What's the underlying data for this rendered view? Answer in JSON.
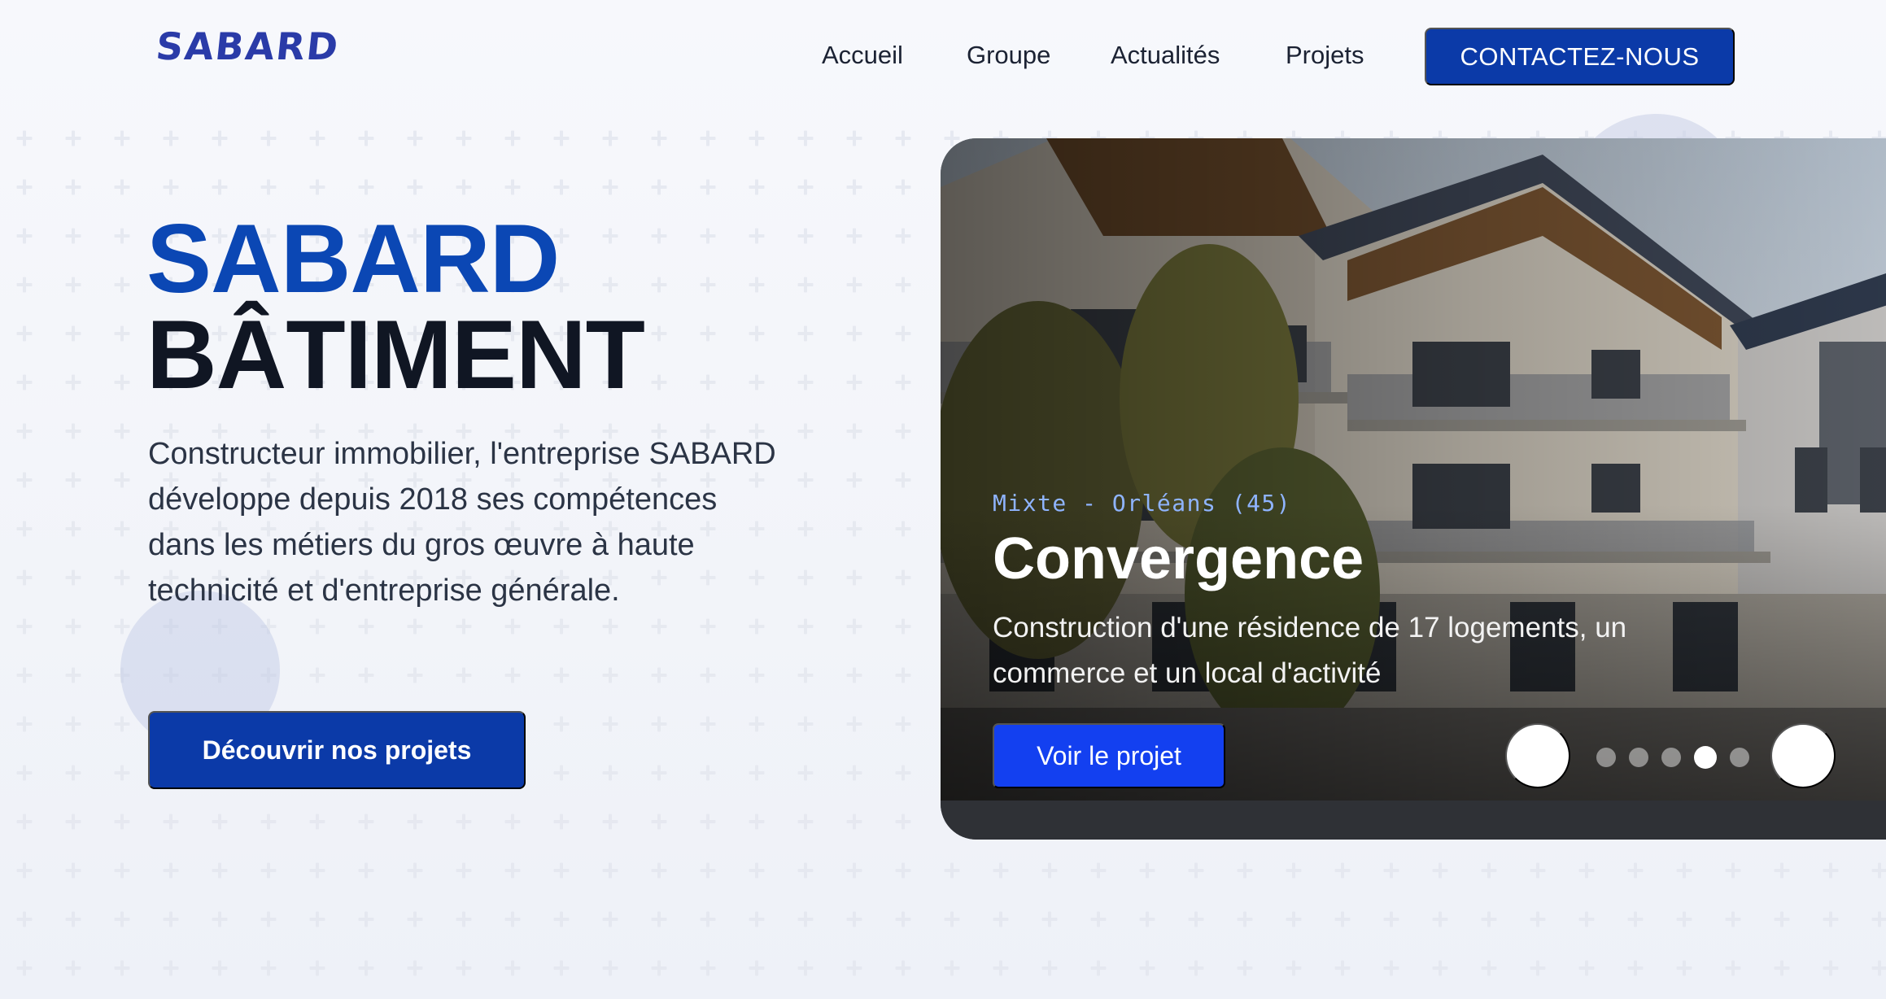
{
  "header": {
    "logo_text": "SABARD",
    "nav": [
      {
        "label": "Accueil"
      },
      {
        "label": "Groupe"
      },
      {
        "label": "Actualités"
      },
      {
        "label": "Projets"
      }
    ],
    "cta_label": "CONTACTEZ-NOUS"
  },
  "hero": {
    "title_line1": "SABARD",
    "title_line2": "BÂTIMENT",
    "lead": "Constructeur immobilier, l'entreprise SABARD développe depuis 2018 ses compétences dans les métiers du gros œuvre à haute technicité et d'entreprise générale.",
    "cta_label": "Découvrir nos projets"
  },
  "slide": {
    "tag": "Mixte - Orléans (45)",
    "title": "Convergence",
    "description": "Construction d'une résidence de 17 logements, un commerce et un local d'activité",
    "button_label": "Voir le projet",
    "slide_count": 5,
    "active_index": 3
  },
  "colors": {
    "brand_blue": "#0b3aa8",
    "title_blue": "#0b47b4",
    "card_button": "#1340f0",
    "tag_blue": "#8fb4ff"
  }
}
